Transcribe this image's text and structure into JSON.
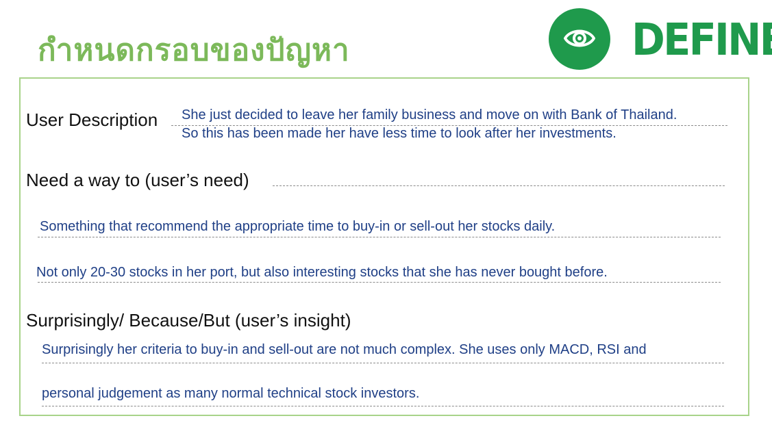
{
  "header": {
    "title": "กำหนดกรอบของปัญหา",
    "logo_text": "DEFINE",
    "logo_icon": "eye-icon",
    "colors": {
      "title_green": "#7cb95a",
      "brand_green": "#1f9a4c",
      "frame_border": "#a8d38a",
      "answer_blue": "#1f3f86"
    }
  },
  "sections": {
    "user_description": {
      "label": "User Description",
      "lines": [
        "She just decided to leave her family business and move on with Bank of Thailand.",
        "So this has been made her have less time to look after her investments."
      ]
    },
    "need": {
      "label": "Need a way to (user’s need)",
      "lines": [
        "Something that recommend the appropriate time to buy-in or sell-out her stocks daily.",
        "Not only 20-30 stocks in her port, but also interesting stocks that she has never bought before."
      ]
    },
    "insight": {
      "label": "Surprisingly/ Because/But (user’s insight)",
      "lines": [
        "Surprisingly her criteria to buy-in and sell-out are not much complex. She uses only MACD, RSI and",
        "personal judgement as many normal technical stock investors."
      ]
    }
  }
}
